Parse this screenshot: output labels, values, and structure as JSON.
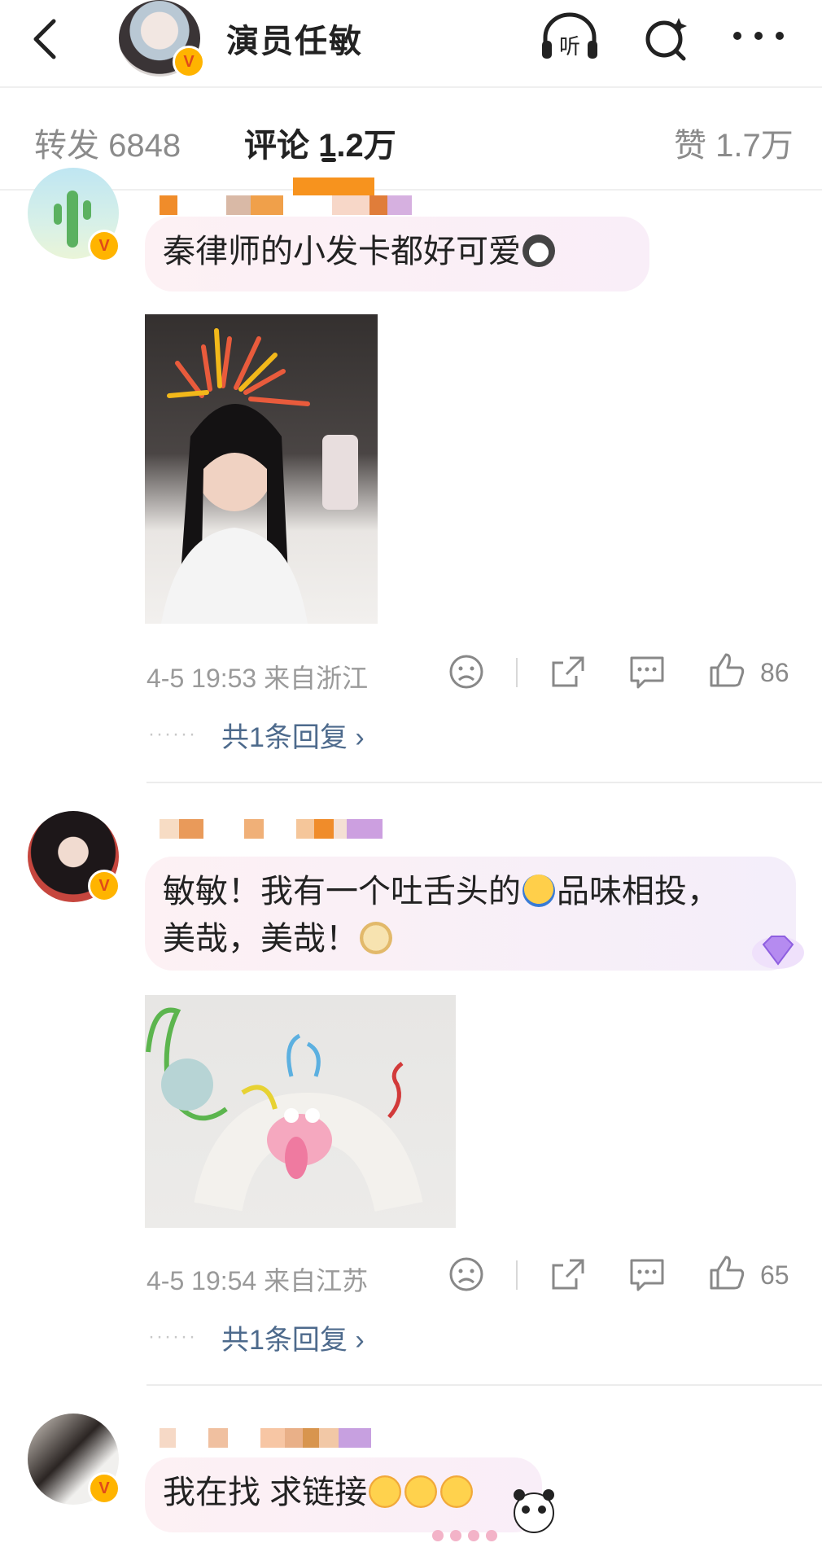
{
  "header": {
    "title": "演员任敏",
    "listen_label": "听",
    "verified": "V"
  },
  "tabs": {
    "repost": "转发 6848",
    "comments": "评论 1.2万",
    "likes": "赞 1.7万"
  },
  "comments": [
    {
      "text": "秦律师的小发卡都好可爱",
      "meta": "4-5 19:53 来自浙江",
      "likes": "86",
      "reply": "共1条回复",
      "reply_chevron": "›"
    },
    {
      "text_line1": "敏敏！我有一个吐舌头的",
      "text_line1_end": "品味相投，",
      "text_line2": "美哉，美哉！",
      "meta": "4-5 19:54 来自江苏",
      "likes": "65",
      "reply": "共1条回复",
      "reply_chevron": "›"
    },
    {
      "text": "我在找 求链接"
    }
  ],
  "ui": {
    "dots": "······"
  },
  "colors": {
    "accent": "#4d6a8c",
    "verified": "#ffb400",
    "bubble_pink": "#fbeef3"
  }
}
